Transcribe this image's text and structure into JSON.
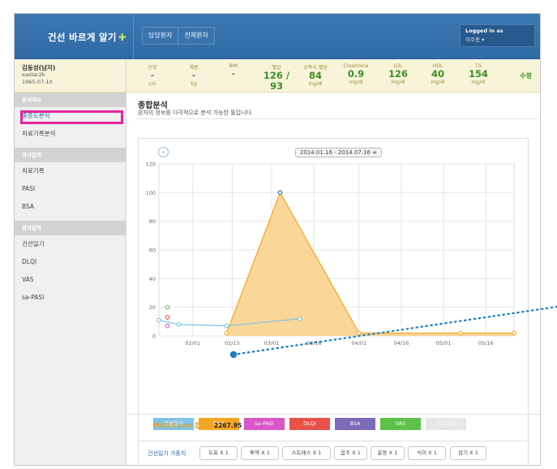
{
  "header": {
    "logo_text": "건선 바르게 알기",
    "logo_mark": "✚",
    "tabs": [
      "담당환자",
      "전체환자"
    ],
    "login_line1": "Logged in as",
    "login_line2": "이주용 ▾"
  },
  "patient": {
    "name": "김동성(남자)",
    "id": "eastar2k",
    "dob": "1965-07-10"
  },
  "sidebar": {
    "section1": "분석메뉴",
    "analysis_items": [
      "중증도분석",
      "치료기록분석"
    ],
    "section2": "의사입력",
    "doctor_items": [
      "치료기록",
      "PASI",
      "BSA"
    ],
    "section3": "환자입력",
    "patient_items": [
      "건선일기",
      "DLQI",
      "VAS",
      "sa-PASI"
    ]
  },
  "stats": [
    {
      "label": "신장",
      "value": "-",
      "unit": "cm"
    },
    {
      "label": "체중",
      "value": "-",
      "unit": "kg"
    },
    {
      "label": "BMI",
      "value": "-",
      "unit": ""
    },
    {
      "label": "혈압",
      "value": "126 / 93",
      "unit": ""
    },
    {
      "label": "공복시 혈당",
      "value": "84",
      "unit": "mg/dl"
    },
    {
      "label": "Creatinine",
      "value": "0.9",
      "unit": "mg/dl"
    },
    {
      "label": "LDL",
      "value": "126",
      "unit": "mg/dl"
    },
    {
      "label": "HDL",
      "value": "40",
      "unit": "mg/dl"
    },
    {
      "label": "TG",
      "value": "154",
      "unit": "mg/dl"
    }
  ],
  "edit_label": "수정",
  "page_title": "종합분석",
  "page_subtitle": "환자의 정보를 다각적으로 분석 가능한 툴입니다.",
  "date_range": "2014.01.16 - 2014.07.16 ≑",
  "prev_icon": "‹",
  "series_buttons": [
    {
      "label": "건선일기",
      "color": "#7fc4e6"
    },
    {
      "label": "PASI",
      "color": "#f5a623"
    },
    {
      "label": "sa-PASI",
      "color": "#d957c6"
    },
    {
      "label": "DLQI",
      "color": "#e8524a"
    },
    {
      "label": "BSA",
      "color": "#7b6bb8"
    },
    {
      "label": "VAS",
      "color": "#5ec24a"
    },
    {
      "label": "치료기록",
      "color": "#e6e6e6"
    }
  ],
  "cause": {
    "label": "건선일기 가중치",
    "chips": [
      "도포 X 1",
      "투약 X 1",
      "스트레스 X 1",
      "음주 X 1",
      "운동 X 1",
      "식이 X 1",
      "감기 X 1"
    ]
  },
  "score": {
    "label": "PASI Score 합계 :",
    "value": "2267.95"
  },
  "chart_data": {
    "type": "area",
    "ylim": [
      0,
      120
    ],
    "yticks": [
      0,
      20,
      40,
      60,
      80,
      100,
      120
    ],
    "xlim": [
      "2014-01-20",
      "2014-05-26"
    ],
    "xticks": [
      "02/01",
      "02/15",
      "03/01",
      "03/16",
      "04/01",
      "04/16",
      "05/01",
      "05/16"
    ],
    "xtick_dates": [
      "2014-02-01",
      "2014-02-15",
      "2014-03-01",
      "2014-03-16",
      "2014-04-01",
      "2014-04-16",
      "2014-05-01",
      "2014-05-16"
    ],
    "series": [
      {
        "name": "PASI",
        "color": "#f5a623",
        "fill": "#f9cf86",
        "dates": [
          "2014-02-13",
          "2014-03-04",
          "2014-04-01",
          "2014-05-07",
          "2014-05-26"
        ],
        "values": [
          2,
          100,
          2,
          2,
          2
        ]
      },
      {
        "name": "건선일기",
        "color": "#7fc4e6",
        "dates": [
          "2014-01-20",
          "2014-01-27",
          "2014-02-13",
          "2014-03-11"
        ],
        "values": [
          11,
          8,
          7,
          12
        ]
      },
      {
        "name": "VAS",
        "color": "#5ec24a",
        "dates": [
          "2014-01-23"
        ],
        "values": [
          20
        ]
      },
      {
        "name": "DLQI",
        "color": "#e8524a",
        "dates": [
          "2014-01-23"
        ],
        "values": [
          13
        ]
      },
      {
        "name": "sa-PASI",
        "color": "#d957c6",
        "dates": [
          "2014-01-23"
        ],
        "values": [
          7
        ]
      }
    ]
  }
}
